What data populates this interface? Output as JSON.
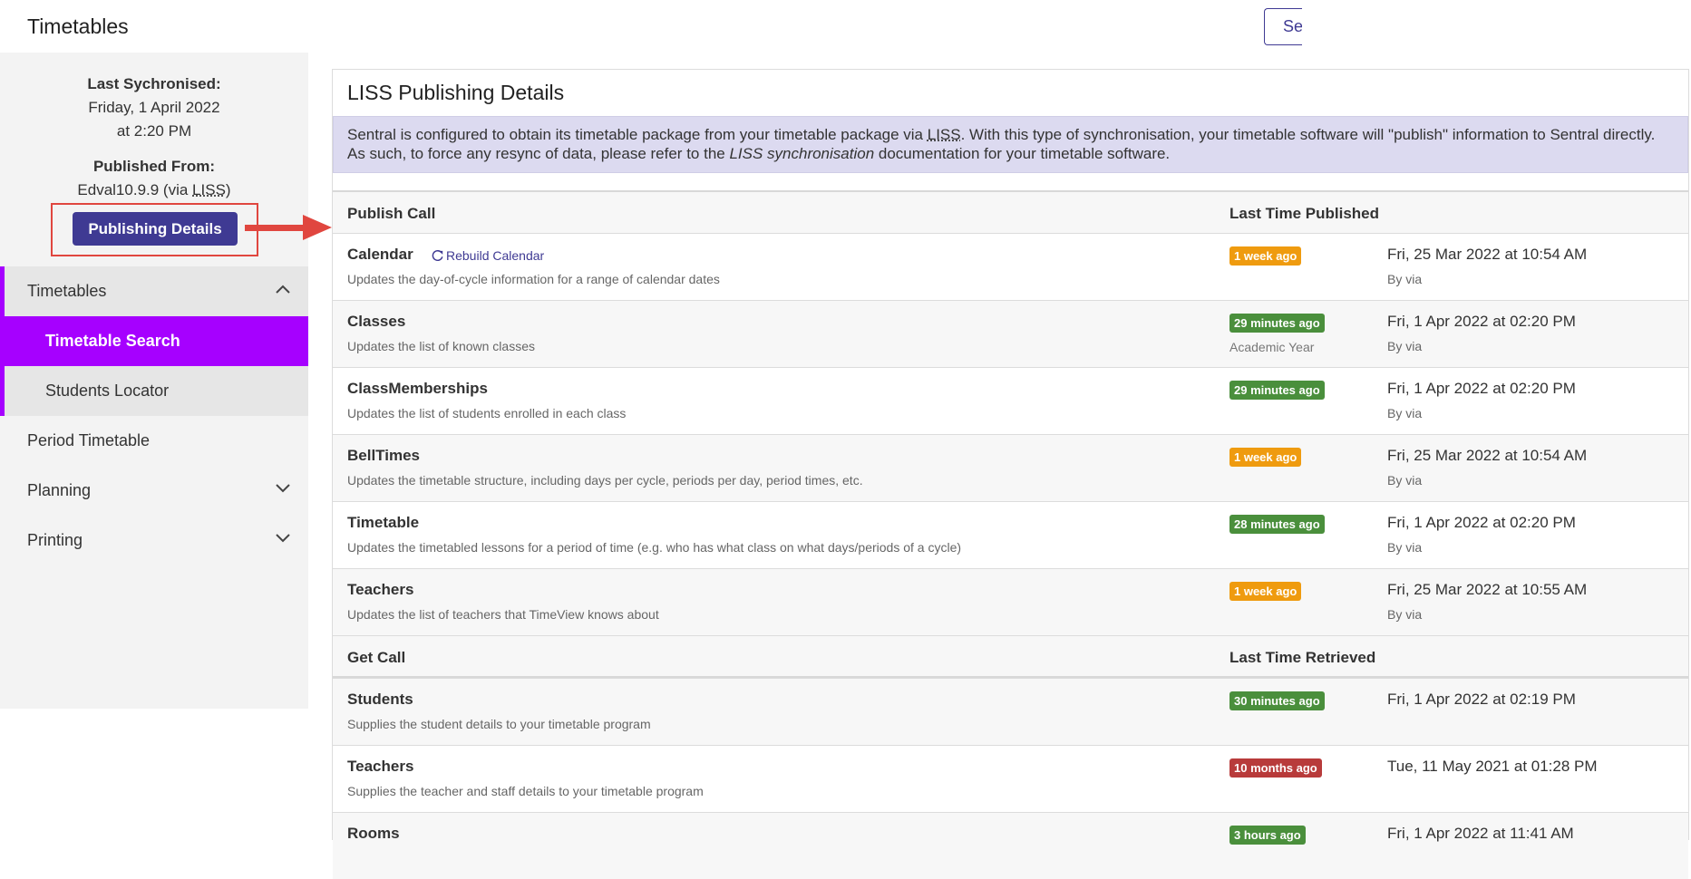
{
  "header": {
    "title": "Timetables",
    "top_button_label": "Se"
  },
  "sidebar": {
    "last_sync_label": "Last Sychronised:",
    "last_sync_date": "Friday, 1 April 2022",
    "last_sync_time": "at 2:20 PM",
    "published_from_label": "Published From:",
    "published_from_value": "Edval10.9.9 (via ",
    "published_from_liss": "LISS",
    "published_from_close": ")",
    "publishing_details_button": "Publishing Details",
    "nav": {
      "timetables": "Timetables",
      "timetable_search": "Timetable Search",
      "students_locator": "Students Locator",
      "period_timetable": "Period Timetable",
      "planning": "Planning",
      "printing": "Printing"
    }
  },
  "main": {
    "title": "LISS Publishing Details",
    "info": {
      "part1": "Sentral is configured to obtain its timetable package from your timetable package via ",
      "liss": "LISS",
      "part2": ". With this type of synchronisation, your timetable software will \"publish\" information to Sentral directly. As such, to force any resync of data, please refer to the ",
      "italic": "LISS synchronisation",
      "part3": " documentation for your timetable software."
    },
    "publish_header": {
      "col1": "Publish Call",
      "col2": "Last Time Published"
    },
    "get_header": {
      "col1": "Get Call",
      "col2": "Last Time Retrieved"
    },
    "rebuild_calendar": "Rebuild Calendar",
    "publish_rows": [
      {
        "name": "Calendar",
        "desc": "Updates the day-of-cycle information for a range of calendar dates",
        "badge": "1 week ago",
        "badge_color": "#ef9b0f",
        "note": "",
        "date": "Fri, 25 Mar 2022 at 10:54 AM",
        "by": "By via"
      },
      {
        "name": "Classes",
        "desc": "Updates the list of known classes",
        "badge": "29 minutes ago",
        "badge_color": "#4a8f3c",
        "note": "Academic Year",
        "date": "Fri, 1 Apr 2022 at 02:20 PM",
        "by": "By via"
      },
      {
        "name": "ClassMemberships",
        "desc": "Updates the list of students enrolled in each class",
        "badge": "29 minutes ago",
        "badge_color": "#4a8f3c",
        "note": "",
        "date": "Fri, 1 Apr 2022 at 02:20 PM",
        "by": "By via"
      },
      {
        "name": "BellTimes",
        "desc": "Updates the timetable structure, including days per cycle, periods per day, period times, etc.",
        "badge": "1 week ago",
        "badge_color": "#ef9b0f",
        "note": "",
        "date": "Fri, 25 Mar 2022 at 10:54 AM",
        "by": "By via"
      },
      {
        "name": "Timetable",
        "desc": "Updates the timetabled lessons for a period of time (e.g. who has what class on what days/periods of a cycle)",
        "badge": "28 minutes ago",
        "badge_color": "#4a8f3c",
        "note": "",
        "date": "Fri, 1 Apr 2022 at 02:20 PM",
        "by": "By via"
      },
      {
        "name": "Teachers",
        "desc": "Updates the list of teachers that TimeView knows about",
        "badge": "1 week ago",
        "badge_color": "#ef9b0f",
        "note": "",
        "date": "Fri, 25 Mar 2022 at 10:55 AM",
        "by": "By via"
      }
    ],
    "get_rows": [
      {
        "name": "Students",
        "desc": "Supplies the student details to your timetable program",
        "badge": "30 minutes ago",
        "badge_color": "#4a8f3c",
        "date": "Fri, 1 Apr 2022 at 02:19 PM"
      },
      {
        "name": "Teachers",
        "desc": "Supplies the teacher and staff details to your timetable program",
        "badge": "10 months ago",
        "badge_color": "#b83b3b",
        "date": "Tue, 11 May 2021 at 01:28 PM"
      },
      {
        "name": "Rooms",
        "desc": "",
        "badge": "3 hours ago",
        "badge_color": "#4a8f3c",
        "date": "Fri, 1 Apr 2022 at 11:41 AM"
      }
    ]
  }
}
